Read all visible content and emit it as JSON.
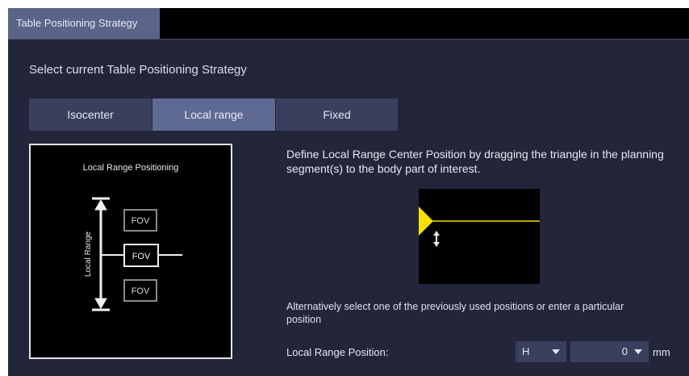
{
  "tab": {
    "label": "Table Positioning Strategy"
  },
  "prompt": "Select current Table Positioning Strategy",
  "strategies": [
    {
      "label": "Isocenter",
      "selected": false
    },
    {
      "label": "Local range",
      "selected": true
    },
    {
      "label": "Fixed",
      "selected": false
    }
  ],
  "diagram": {
    "title": "Local Range Positioning",
    "axis_label": "Local Range",
    "fov_labels": [
      "FOV",
      "FOV",
      "FOV"
    ]
  },
  "description": "Define Local Range Center Position by dragging the triangle in the planning segment(s) to the body part of interest.",
  "preview": {
    "marker_color": "#f5e000",
    "cursor_icon": "vertical-resize-cursor-icon"
  },
  "alternative_text": "Alternatively select one of the previously used positions or enter a particular position",
  "position": {
    "label": "Local Range Position:",
    "direction": "H",
    "value": "0",
    "unit": "mm"
  },
  "colors": {
    "panel_bg": "#23253a",
    "tab_active": "#5a6388",
    "segment_selected": "#5f6a93",
    "segment_normal": "#3a3f5e"
  }
}
